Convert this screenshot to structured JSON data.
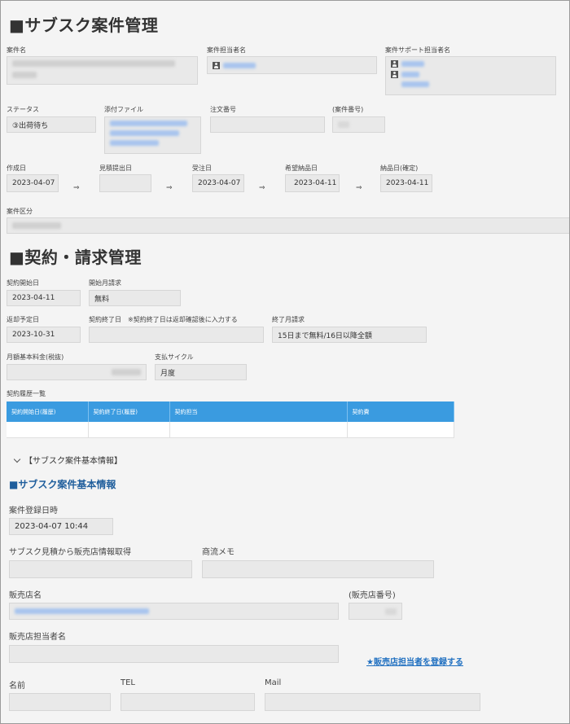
{
  "section1": {
    "title": "■サブスク案件管理",
    "case_name_label": "案件名",
    "assignee_label": "案件担当者名",
    "support_label": "案件サポート担当者名",
    "status_label": "ステータス",
    "status_value": "③出荷待ち",
    "attachment_label": "添付ファイル",
    "order_no_label": "注文番号",
    "case_no_label": "(案件番号)",
    "created_label": "作成日",
    "created_value": "2023-04-07",
    "estimate_label": "見積提出日",
    "ordered_label": "受注日",
    "ordered_value": "2023-04-07",
    "desired_label": "希望納品日",
    "desired_value": "2023-04-11",
    "delivered_label": "納品日(確定)",
    "delivered_value": "2023-04-11",
    "category_label": "案件区分",
    "arrow": "⇒"
  },
  "section2": {
    "title": "■契約・請求管理",
    "start_label": "契約開始日",
    "start_value": "2023-04-11",
    "first_month_label": "開始月請求",
    "first_month_value": "無料",
    "return_label": "返却予定日",
    "return_value": "2023-10-31",
    "end_label": "契約終了日　※契約終了日は返却確認後に入力する",
    "last_month_label": "終了月請求",
    "last_month_value": "15日まで無料/16日以降全額",
    "monthly_fee_label": "月額基本料金(税抜)",
    "cycle_label": "支払サイクル",
    "cycle_value": "月度",
    "history_label": "契約履歴一覧",
    "history_columns": [
      "契約開始日(履歴)",
      "契約終了日(履歴)",
      "契約担当",
      "契約費"
    ]
  },
  "section3": {
    "toggle_label": "【サブスク案件基本情報】",
    "title": "■サブスク案件基本情報",
    "registered_label": "案件登録日時",
    "registered_value": "2023-04-07 10:44",
    "estimate_dealer_label": "サブスク見積から販売店情報取得",
    "memo_label": "商流メモ",
    "dealer_label": "販売店名",
    "dealer_no_label": "(販売店番号)",
    "dealer_person_label": "販売店担当者名",
    "register_link": "★販売店担当者を登録する",
    "name_label": "名前",
    "tel_label": "TEL",
    "mail_label": "Mail"
  }
}
